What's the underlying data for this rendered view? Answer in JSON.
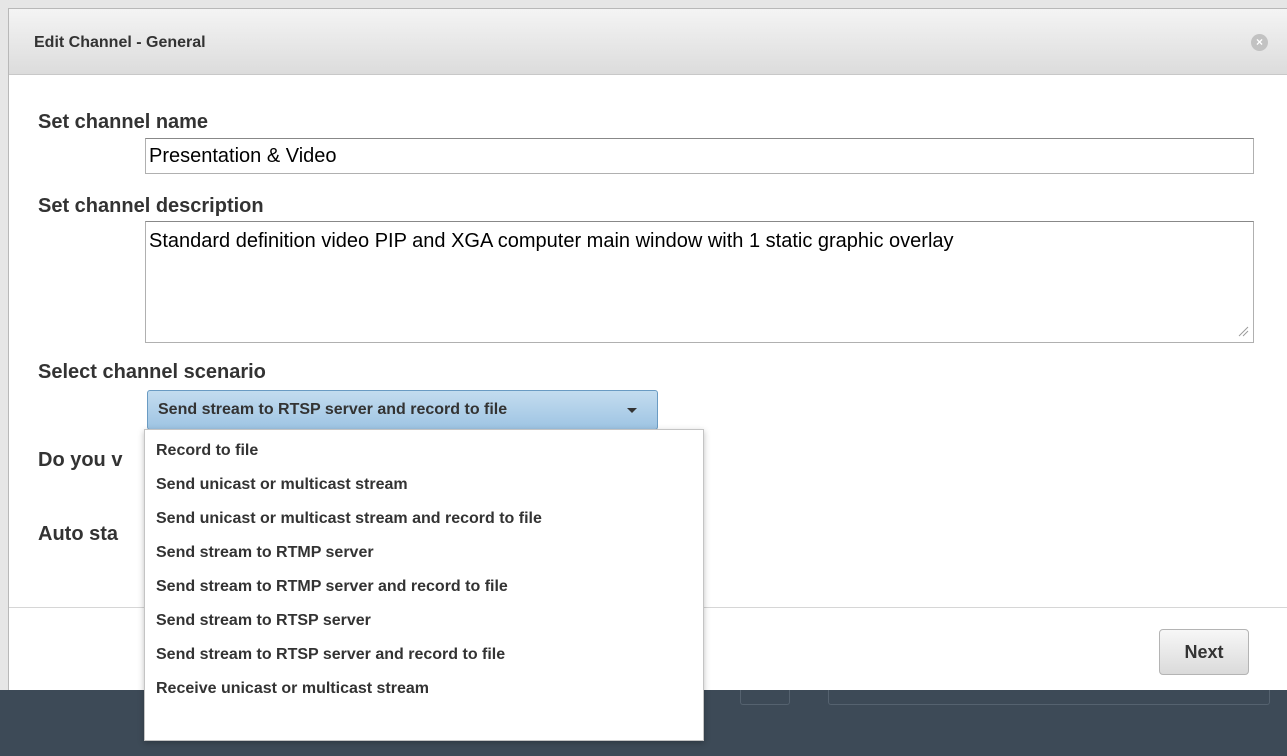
{
  "dialog": {
    "title": "Edit Channel - General",
    "close_icon": "close-icon"
  },
  "fields": {
    "name_label": "Set channel name",
    "name_value": "Presentation & Video",
    "description_label": "Set channel description",
    "description_value": "Standard definition video PIP and XGA computer main window with 1 static graphic overlay",
    "scenario_label": "Select channel scenario",
    "scenario_selected": "Send stream to RTSP server and record to file",
    "partial_label_1": "Do you v",
    "partial_label_2": "Auto sta"
  },
  "scenario_options": [
    "Record to file",
    "Send unicast or multicast stream",
    "Send unicast or multicast stream and record to file",
    "Send stream to RTMP server",
    "Send stream to RTMP server and record to file",
    "Send stream to RTSP server",
    "Send stream to RTSP server and record to file",
    "Receive unicast or multicast stream"
  ],
  "footer": {
    "next_label": "Next"
  },
  "colors": {
    "select_accent": "#9ec4e3",
    "bottom_bar": "#3d4a57"
  }
}
